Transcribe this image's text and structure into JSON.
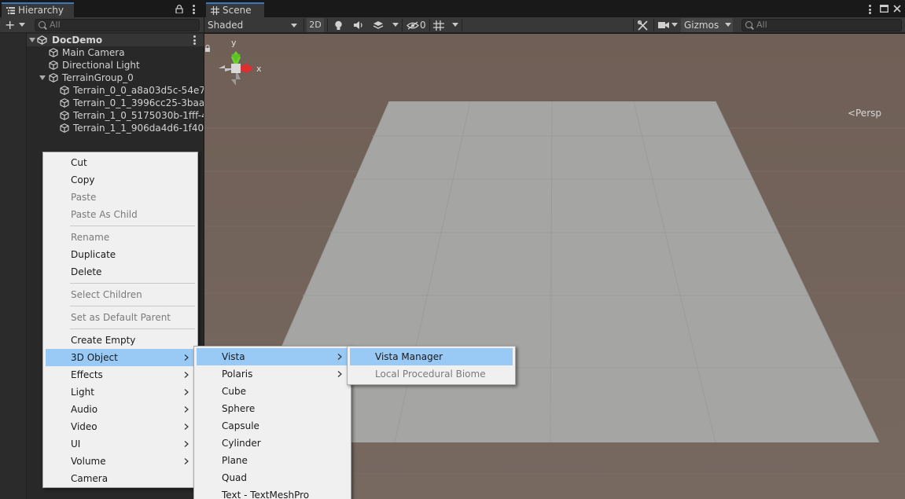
{
  "hierarchy": {
    "tab_label": "Hierarchy",
    "search_placeholder": "All",
    "scene_name": "DocDemo",
    "items": [
      {
        "label": "Main Camera"
      },
      {
        "label": "Directional Light"
      },
      {
        "label": "TerrainGroup_0"
      },
      {
        "label": "Terrain_0_0_a8a03d5c-54e7"
      },
      {
        "label": "Terrain_0_1_3996cc25-3baa-"
      },
      {
        "label": "Terrain_1_0_5175030b-1fff-4"
      },
      {
        "label": "Terrain_1_1_906da4d6-1f40-"
      }
    ]
  },
  "scene": {
    "tab_label": "Scene",
    "shading_mode": "Shaded",
    "mode_2d": "2D",
    "hidden_count": "0",
    "gizmos_label": "Gizmos",
    "search_placeholder": "All",
    "projection_label": "Persp",
    "gizmo_axes": {
      "y": "y",
      "x": "x"
    }
  },
  "context_menu": {
    "items": [
      {
        "label": "Cut",
        "enabled": true
      },
      {
        "label": "Copy",
        "enabled": true
      },
      {
        "label": "Paste",
        "enabled": false
      },
      {
        "label": "Paste As Child",
        "enabled": false
      },
      {
        "label": "Rename",
        "enabled": false
      },
      {
        "label": "Duplicate",
        "enabled": true
      },
      {
        "label": "Delete",
        "enabled": true
      },
      {
        "label": "Select Children",
        "enabled": false
      },
      {
        "label": "Set as Default Parent",
        "enabled": false
      },
      {
        "label": "Create Empty",
        "enabled": true
      },
      {
        "label": "3D Object",
        "enabled": true,
        "highlighted": true
      },
      {
        "label": "Effects",
        "enabled": true
      },
      {
        "label": "Light",
        "enabled": true
      },
      {
        "label": "Audio",
        "enabled": true
      },
      {
        "label": "Video",
        "enabled": true
      },
      {
        "label": "UI",
        "enabled": true
      },
      {
        "label": "Volume",
        "enabled": true
      },
      {
        "label": "Camera",
        "enabled": true
      }
    ]
  },
  "submenu_3d": {
    "items": [
      {
        "label": "Vista",
        "highlighted": true
      },
      {
        "label": "Polaris"
      },
      {
        "label": "Cube"
      },
      {
        "label": "Sphere"
      },
      {
        "label": "Capsule"
      },
      {
        "label": "Cylinder"
      },
      {
        "label": "Plane"
      },
      {
        "label": "Quad"
      },
      {
        "label": "Text - TextMeshPro"
      }
    ]
  },
  "submenu_vista": {
    "items": [
      {
        "label": "Vista Manager",
        "enabled": true,
        "highlighted": true
      },
      {
        "label": "Local Procedural Biome",
        "enabled": false
      }
    ]
  },
  "colors": {
    "editor_bg": "#282828",
    "toolbar": "#383838",
    "viewport_bg": "#716158",
    "ground": "#a5a5a3",
    "menu_bg": "#f0f0f0",
    "menu_highlight": "#99c9f5",
    "tab_accent": "#3a79bb"
  }
}
